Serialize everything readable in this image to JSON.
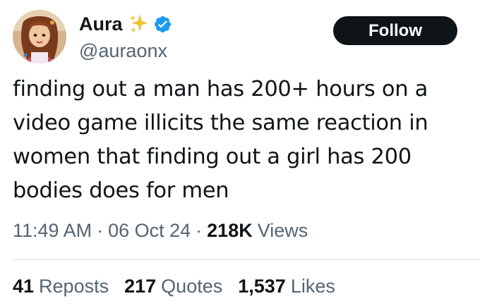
{
  "user": {
    "display_name": "Aura",
    "handle": "@auraonx",
    "name_emoji_icon": "sparkles-icon",
    "verified_icon": "verified-badge-icon",
    "verified_color": "#1d9bf0"
  },
  "follow_button": {
    "label": "Follow"
  },
  "tweet": {
    "text": "finding out a man has 200+ hours on a\nvideo game illicits the same reaction in\nwomen that finding out a girl has 200\nbodies does for men"
  },
  "meta": {
    "time": "11:49 AM",
    "separator": "·",
    "date": "06 Oct 24",
    "views_count": "218K",
    "views_label": "Views"
  },
  "stats": {
    "reposts_count": "41",
    "reposts_label": "Reposts",
    "quotes_count": "217",
    "quotes_label": "Quotes",
    "likes_count": "1,537",
    "likes_label": "Likes"
  },
  "colors": {
    "text_primary": "#0f1419",
    "text_secondary": "#536471",
    "button_bg": "#0f1419",
    "divider": "#cfd9de"
  }
}
